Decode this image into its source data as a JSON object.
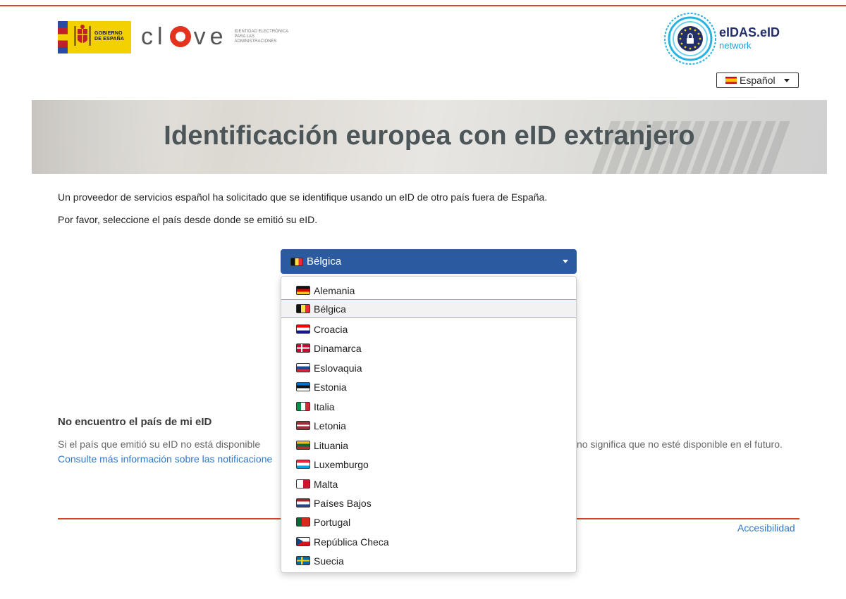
{
  "header": {
    "gov_logo_lines": [
      "GOBIERNO",
      "DE ESPAÑA"
    ],
    "clave_brand": {
      "left": "cl",
      "right": "ve"
    },
    "clave_tagline": "IDENTIDAD ELECTRÓNICA PARA LAS ADMINISTRACIONES",
    "eidas_title": "eIDAS.eID",
    "eidas_subtitle": "network",
    "language_selector": {
      "selected": "Español"
    }
  },
  "hero": {
    "title": "Identificación europea con eID extranjero"
  },
  "intro": {
    "line1": "Un proveedor de servicios español ha solicitado que se identifique usando un eID de otro país fuera de España.",
    "line2": "Por favor, seleccione el país desde donde se emitió su eID."
  },
  "country_select": {
    "selected": "Bélgica",
    "options": [
      {
        "label": "Alemania",
        "flag": "alemania"
      },
      {
        "label": "Bélgica",
        "flag": "belgica",
        "selected": true
      },
      {
        "label": "Croacia",
        "flag": "croacia"
      },
      {
        "label": "Dinamarca",
        "flag": "dinamarca"
      },
      {
        "label": "Eslovaquia",
        "flag": "eslovaquia"
      },
      {
        "label": "Estonia",
        "flag": "estonia"
      },
      {
        "label": "Italia",
        "flag": "italia"
      },
      {
        "label": "Letonia",
        "flag": "letonia"
      },
      {
        "label": "Lituania",
        "flag": "lituania"
      },
      {
        "label": "Luxemburgo",
        "flag": "luxemburgo"
      },
      {
        "label": "Malta",
        "flag": "malta"
      },
      {
        "label": "Países Bajos",
        "flag": "paises-bajos"
      },
      {
        "label": "Portugal",
        "flag": "portugal"
      },
      {
        "label": "República Checa",
        "flag": "republica-checa"
      },
      {
        "label": "Suecia",
        "flag": "suecia"
      }
    ]
  },
  "info": {
    "heading": "No encuentro el país de mi eID",
    "text_left": "Si el país que emitió su eID no está disponible",
    "text_right": "no significa que no esté disponible en el futuro.",
    "link_text": "Consulte más información sobre las notificacione"
  },
  "footer": {
    "accessibility_link": "Accesibilidad"
  },
  "colors": {
    "accent_red": "#d9412b",
    "select_blue": "#2b5aa0",
    "link_blue": "#2f78c4",
    "eidas_navy": "#232f6b"
  }
}
